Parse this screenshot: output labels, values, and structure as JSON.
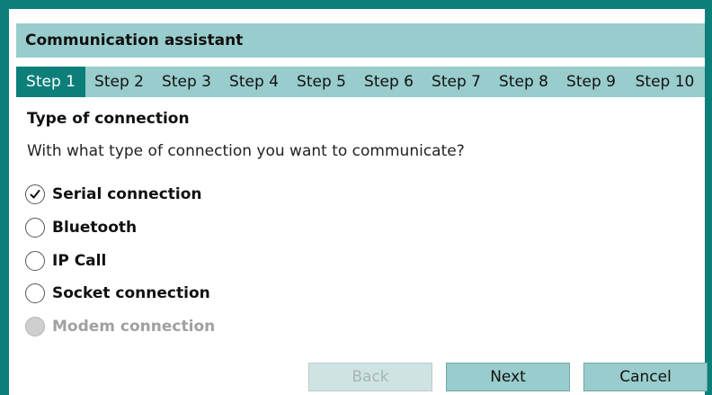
{
  "window": {
    "title": "Communication assistant"
  },
  "steps": [
    {
      "label": "Step 1",
      "active": true
    },
    {
      "label": "Step 2"
    },
    {
      "label": "Step 3"
    },
    {
      "label": "Step 4"
    },
    {
      "label": "Step 5"
    },
    {
      "label": "Step 6"
    },
    {
      "label": "Step 7"
    },
    {
      "label": "Step 8"
    },
    {
      "label": "Step 9"
    },
    {
      "label": "Step 10"
    }
  ],
  "content": {
    "section_title": "Type of connection",
    "question": "With what type of connection you want to communicate?",
    "options": [
      {
        "label": "Serial connection",
        "selected": true
      },
      {
        "label": "Bluetooth"
      },
      {
        "label": "IP Call"
      },
      {
        "label": "Socket connection"
      },
      {
        "label": "Modem connection",
        "disabled": true
      }
    ]
  },
  "buttons": {
    "back": "Back",
    "next": "Next",
    "cancel": "Cancel"
  },
  "colors": {
    "accent": "#0c7f7a",
    "header": "#99cccc",
    "disabled": "#cfcfcf"
  }
}
